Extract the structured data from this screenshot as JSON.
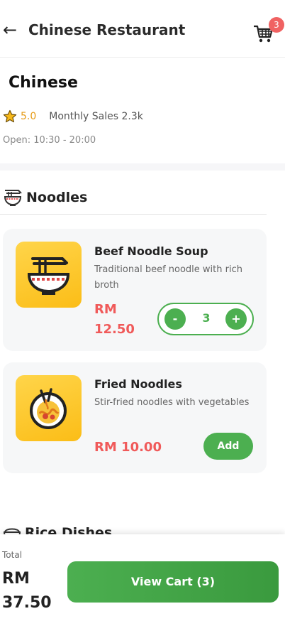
{
  "header": {
    "back_icon": "arrow-left-icon",
    "title": "Chinese Restaurant",
    "cart_icon": "shopping-cart-icon",
    "cart_count": "3",
    "badge_color": "#f06262"
  },
  "store": {
    "name": "Chinese",
    "rating": "5.0",
    "sales": "Monthly Sales 2.3k",
    "hours": "Open: 10:30 - 20:00"
  },
  "sections": [
    {
      "title": "Noodles",
      "icon": "noodle-bowl-icon",
      "items": [
        {
          "name": "Beef Noodle Soup",
          "description": "Traditional beef noodle with rich broth",
          "price": "RM 12.50",
          "quantity": "3",
          "minus_label": "-",
          "plus_label": "+",
          "icon": "noodle-bowl-icon"
        },
        {
          "name": "Fried Noodles",
          "description": "Stir-fried noodles with vegetables",
          "price": "RM 10.00",
          "add_label": "Add",
          "icon": "fried-noodles-icon"
        }
      ]
    },
    {
      "title": "Rice Dishes",
      "icon": "rice-bowl-icon"
    }
  ],
  "footer": {
    "total_label": "Total",
    "total_value": "RM 37.50",
    "view_cart_label": "View Cart (3)"
  },
  "colors": {
    "accent": "#4caf50",
    "price": "#f05a5a",
    "rating": "#e69a14"
  }
}
